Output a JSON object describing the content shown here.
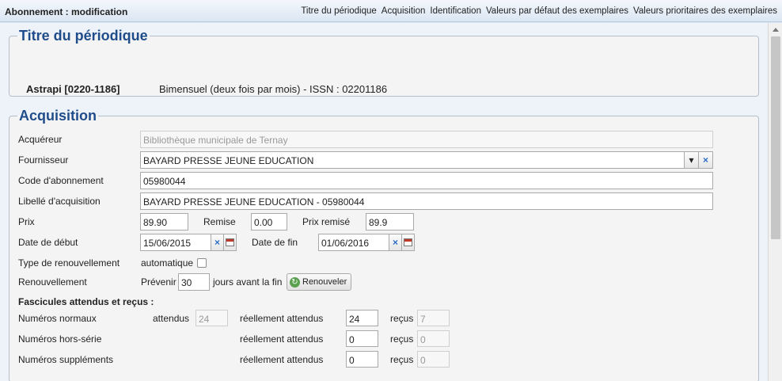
{
  "header": {
    "title": "Abonnement : modification",
    "links": [
      "Titre du périodique",
      "Acquisition",
      "Identification",
      "Valeurs par défaut des exemplaires",
      "Valeurs prioritaires des exemplaires"
    ]
  },
  "titre": {
    "legend": "Titre du périodique",
    "name": "Astrapi [0220-1186]",
    "details": "Bimensuel (deux fois par mois) - ISSN : 02201186"
  },
  "acquisition": {
    "legend": "Acquisition",
    "acquereur_label": "Acquéreur",
    "acquereur_value": "Bibliothèque municipale de Ternay",
    "fournisseur_label": "Fournisseur",
    "fournisseur_value": "BAYARD PRESSE JEUNE EDUCATION",
    "code_label": "Code d'abonnement",
    "code_value": "05980044",
    "libelle_label": "Libellé d'acquisition",
    "libelle_value": "BAYARD PRESSE JEUNE EDUCATION - 05980044",
    "prix_label": "Prix",
    "prix_value": "89.90",
    "remise_label": "Remise",
    "remise_value": "0.00",
    "prix_remise_label": "Prix remisé",
    "prix_remise_value": "89.9",
    "date_debut_label": "Date de début",
    "date_debut_value": "15/06/2015",
    "date_fin_label": "Date de fin",
    "date_fin_value": "01/06/2016",
    "type_renouv_label": "Type de renouvellement",
    "automatique_label": "automatique",
    "renouv_label": "Renouvellement",
    "prevenir_label": "Prévenir",
    "prevenir_value": "30",
    "jours_label": "jours avant la fin",
    "renouveler_button": "Renouveler",
    "fascicules_heading": "Fascicules attendus et reçus :",
    "attendus_label": "attendus",
    "reellement_label": "réellement attendus",
    "recus_label": "reçus",
    "rows": [
      {
        "label": "Numéros normaux",
        "attendus": "24",
        "reellement": "24",
        "recus": "7"
      },
      {
        "label": "Numéros hors-série",
        "reellement": "0",
        "recus": "0"
      },
      {
        "label": "Numéros suppléments",
        "reellement": "0",
        "recus": "0"
      }
    ]
  },
  "icons": {
    "clear": "×",
    "dropdown": "▾",
    "renew": "↻"
  }
}
